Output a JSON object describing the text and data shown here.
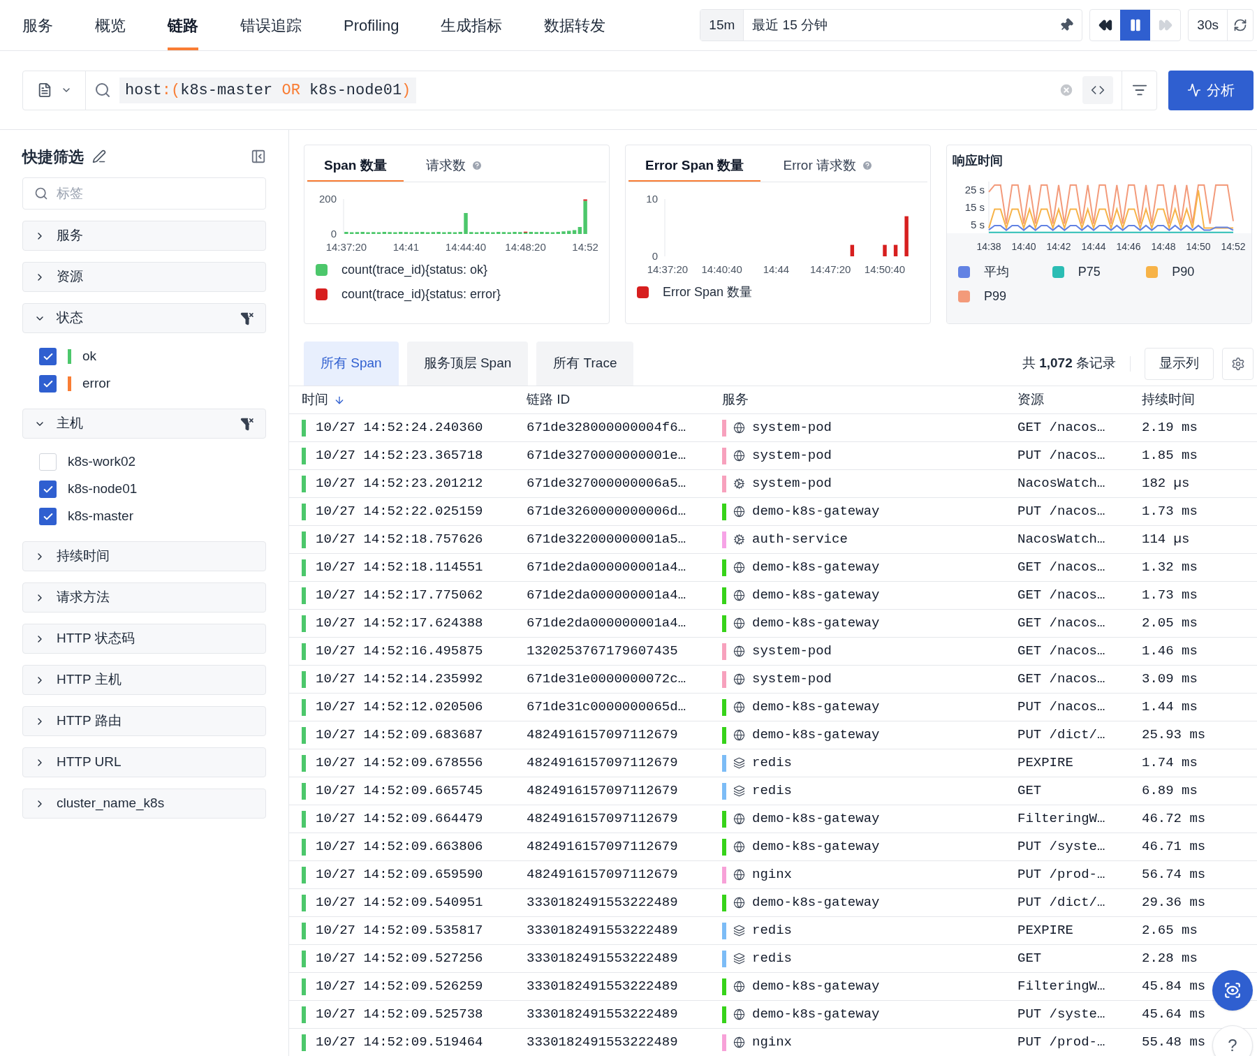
{
  "nav": {
    "tabs": [
      {
        "label": "服务",
        "selected": false
      },
      {
        "label": "概览",
        "selected": false
      },
      {
        "label": "链路",
        "selected": true
      },
      {
        "label": "错误追踪",
        "selected": false
      },
      {
        "label": "Profiling",
        "selected": false
      },
      {
        "label": "生成指标",
        "selected": false
      },
      {
        "label": "数据转发",
        "selected": false
      }
    ],
    "time_range": {
      "short": "15m",
      "label": "最近 15 分钟"
    },
    "live": true,
    "refresh": "30s"
  },
  "query": {
    "tokens": [
      {
        "text": "host",
        "kind": "field"
      },
      {
        "text": ":(",
        "kind": "op"
      },
      {
        "text": "k8s-master ",
        "kind": "value"
      },
      {
        "text": "OR",
        "kind": "op"
      },
      {
        "text": " k8s-node01",
        "kind": "value"
      },
      {
        "text": ")",
        "kind": "op"
      }
    ],
    "analyze_button": "分析"
  },
  "quick_filter": {
    "title": "快捷筛选",
    "placeholder": "标签",
    "groups": [
      {
        "label": "服务",
        "expanded": false
      },
      {
        "label": "资源",
        "expanded": false
      },
      {
        "label": "状态",
        "expanded": true,
        "items": [
          {
            "label": "ok",
            "checked": true,
            "color": "#4cc76b"
          },
          {
            "label": "error",
            "checked": true,
            "color": "#f97d34"
          }
        ]
      },
      {
        "label": "主机",
        "expanded": true,
        "items": [
          {
            "label": "k8s-work02",
            "checked": false
          },
          {
            "label": "k8s-node01",
            "checked": true
          },
          {
            "label": "k8s-master",
            "checked": true
          }
        ]
      },
      {
        "label": "持续时间",
        "expanded": false
      },
      {
        "label": "请求方法",
        "expanded": false
      },
      {
        "label": "HTTP 状态码",
        "expanded": false
      },
      {
        "label": "HTTP 主机",
        "expanded": false
      },
      {
        "label": "HTTP 路由",
        "expanded": false
      },
      {
        "label": "HTTP URL",
        "expanded": false
      },
      {
        "label": "cluster_name_k8s",
        "expanded": false
      }
    ]
  },
  "charts": [
    {
      "tabs": [
        {
          "label": "Span 数量",
          "selected": true,
          "help": false
        },
        {
          "label": "请求数",
          "selected": false,
          "help": true
        }
      ],
      "chart_data": {
        "type": "bar",
        "stacked": true,
        "ylim": [
          0,
          200
        ],
        "yticks": [
          0,
          200
        ],
        "categories": [
          "14:37:20",
          null,
          null,
          null,
          null,
          null,
          null,
          null,
          null,
          null,
          null,
          "14:41",
          null,
          null,
          null,
          null,
          null,
          null,
          null,
          null,
          null,
          null,
          "14:44:40",
          null,
          null,
          null,
          null,
          null,
          null,
          null,
          null,
          null,
          null,
          "14:48:20",
          null,
          null,
          null,
          null,
          null,
          null,
          null,
          null,
          null,
          null,
          "14:52"
        ],
        "series": [
          {
            "name": "count(trace_id){status: ok}",
            "color": "#4cc76b",
            "values": [
              12,
              10,
              11,
              12,
              10,
              11,
              10,
              12,
              11,
              10,
              12,
              11,
              10,
              11,
              12,
              10,
              11,
              12,
              10,
              11,
              10,
              12,
              120,
              11,
              10,
              12,
              11,
              10,
              12,
              11,
              10,
              12,
              11,
              8,
              12,
              11,
              12,
              11,
              10,
              12,
              15,
              18,
              22,
              40,
              190
            ]
          },
          {
            "name": "count(trace_id){status: error}",
            "color": "#d71f1f",
            "values": [
              null,
              null,
              null,
              null,
              null,
              null,
              null,
              null,
              null,
              null,
              null,
              null,
              null,
              null,
              null,
              null,
              null,
              null,
              null,
              null,
              null,
              null,
              null,
              null,
              null,
              null,
              null,
              null,
              null,
              null,
              null,
              null,
              null,
              5,
              null,
              null,
              null,
              null,
              null,
              null,
              null,
              null,
              null,
              null,
              8
            ]
          }
        ]
      }
    },
    {
      "tabs": [
        {
          "label": "Error Span 数量",
          "selected": true,
          "help": false
        },
        {
          "label": "Error 请求数",
          "selected": false,
          "help": true
        }
      ],
      "chart_data": {
        "type": "bar",
        "stacked": false,
        "ylim": [
          0,
          10
        ],
        "yticks": [
          0,
          10
        ],
        "categories": [
          "14:37:20",
          null,
          null,
          null,
          null,
          null,
          null,
          null,
          null,
          null,
          "14:40:40",
          null,
          null,
          null,
          null,
          null,
          null,
          null,
          null,
          null,
          "14:44",
          null,
          null,
          null,
          null,
          null,
          null,
          null,
          null,
          null,
          "14:47:20",
          null,
          null,
          null,
          null,
          null,
          null,
          null,
          null,
          null,
          "14:50:40",
          null,
          null,
          null,
          null
        ],
        "series": [
          {
            "name": "Error Span 数量",
            "color": "#d71f1f",
            "values": [
              0,
              0,
              0,
              0,
              0,
              0,
              0,
              0,
              0,
              0,
              0,
              0,
              0,
              0,
              0,
              0,
              0,
              0,
              0,
              0,
              0,
              0,
              0,
              0,
              0,
              0,
              0,
              0,
              0,
              0,
              0,
              0,
              0,
              0,
              2,
              0,
              0,
              0,
              0,
              0,
              2,
              0,
              2,
              0,
              7
            ]
          }
        ]
      }
    },
    {
      "title": "响应时间",
      "chart_data": {
        "type": "line",
        "ylim": [
          0,
          30
        ],
        "yticks": [
          {
            "value": 5,
            "label": "5 s"
          },
          {
            "value": 15,
            "label": "15 s"
          },
          {
            "value": 25,
            "label": "25 s"
          }
        ],
        "categories": [
          "14:38",
          null,
          null,
          null,
          null,
          null,
          "14:40",
          null,
          null,
          null,
          null,
          null,
          "14:42",
          null,
          null,
          null,
          null,
          null,
          "14:44",
          null,
          null,
          null,
          null,
          null,
          "14:46",
          null,
          null,
          null,
          null,
          null,
          "14:48",
          null,
          null,
          null,
          null,
          null,
          "14:50",
          null,
          null,
          null,
          null,
          null,
          "14:52"
        ],
        "series": [
          {
            "name": "平均",
            "color": "#6282e3",
            "values": [
              2,
              4.5,
              4.5,
              1.8,
              4.5,
              4.5,
              1.8,
              4.5,
              1.8,
              4.5,
              4.5,
              1.8,
              4.5,
              1.8,
              4.5,
              4.5,
              1.8,
              4.5,
              1.8,
              4.5,
              4.5,
              1.8,
              4.5,
              1.8,
              4.5,
              4.5,
              1.8,
              4.5,
              1.8,
              4.5,
              4.5,
              1.8,
              4.5,
              1.8,
              4.5,
              1.8,
              4.5,
              1.8,
              1.8,
              3.5,
              3.5,
              3.5,
              1.8
            ]
          },
          {
            "name": "P75",
            "color": "#2bbdb4",
            "values": [
              0.5,
              0.5,
              0.5,
              0.5,
              0.5,
              0.5,
              0.5,
              0.5,
              0.5,
              0.5,
              0.5,
              0.5,
              0.5,
              0.5,
              0.5,
              0.5,
              0.5,
              0.5,
              0.5,
              0.5,
              0.5,
              0.5,
              0.5,
              0.5,
              0.5,
              0.5,
              0.5,
              0.5,
              0.5,
              0.5,
              0.5,
              0.5,
              0.5,
              0.5,
              0.5,
              0.5,
              0.5,
              0.5,
              0.5,
              0.5,
              0.5,
              0.5,
              0.5
            ]
          },
          {
            "name": "P90",
            "color": "#f7b348",
            "values": [
              3,
              14,
              14,
              3,
              14,
              14,
              3,
              14,
              3,
              14,
              14,
              3,
              14,
              3,
              14,
              14,
              3,
              14,
              3,
              14,
              14,
              3,
              14,
              3,
              14,
              14,
              3,
              14,
              3,
              14,
              14,
              3,
              14,
              3,
              14,
              3,
              25,
              3,
              3,
              3,
              3,
              3,
              3
            ]
          },
          {
            "name": "P99",
            "color": "#f39a7a",
            "values": [
              24,
              28,
              28,
              5.5,
              28,
              28,
              5.5,
              28,
              5.5,
              28,
              28,
              5.5,
              28,
              5.5,
              28,
              28,
              5.5,
              28,
              5.5,
              28,
              28,
              5.5,
              28,
              5.5,
              28,
              28,
              5.5,
              28,
              5.5,
              28,
              28,
              5.5,
              28,
              5.5,
              28,
              5.5,
              28,
              28,
              5.5,
              28,
              28,
              28,
              7
            ]
          }
        ]
      }
    }
  ],
  "table_tabs": [
    {
      "label": "所有 Span",
      "selected": true
    },
    {
      "label": "服务顶层 Span",
      "selected": false
    },
    {
      "label": "所有 Trace",
      "selected": false
    }
  ],
  "record_count": "共 **1,072** 条记录",
  "columns_button": "显示列",
  "table": {
    "columns": [
      {
        "label": "时间",
        "sorted": true
      },
      {
        "label": "链路 ID",
        "sorted": false
      },
      {
        "label": "服务",
        "sorted": false
      },
      {
        "label": "资源",
        "sorted": false
      },
      {
        "label": "持续时间",
        "sorted": false
      }
    ],
    "rows": [
      {
        "error": false,
        "time": "10/27 14:52:24.240360",
        "trace_id": "671de328000000004f6…",
        "service": "system-pod",
        "kind": "web",
        "color": "#f7a1bd",
        "resource": "GET /nacos…",
        "duration": "2.19 ms"
      },
      {
        "error": false,
        "time": "10/27 14:52:23.365718",
        "trace_id": "671de3270000000001e…",
        "service": "system-pod",
        "kind": "web",
        "color": "#f7a1bd",
        "resource": "PUT /nacos…",
        "duration": "1.85 ms"
      },
      {
        "error": false,
        "time": "10/27 14:52:23.201212",
        "trace_id": "671de327000000006a5…",
        "service": "system-pod",
        "kind": "app",
        "color": "#f7a1bd",
        "resource": "NacosWatch…",
        "duration": "182 µs"
      },
      {
        "error": false,
        "time": "10/27 14:52:22.025159",
        "trace_id": "671de3260000000006d…",
        "service": "demo-k8s-gateway",
        "kind": "web",
        "color": "#37d31a",
        "resource": "PUT /nacos…",
        "duration": "1.73 ms"
      },
      {
        "error": false,
        "time": "10/27 14:52:18.757626",
        "trace_id": "671de322000000001a5…",
        "service": "auth-service",
        "kind": "app",
        "color": "#f6a3e6",
        "resource": "NacosWatch…",
        "duration": "114 µs"
      },
      {
        "error": false,
        "time": "10/27 14:52:18.114551",
        "trace_id": "671de2da000000001a4…",
        "service": "demo-k8s-gateway",
        "kind": "web",
        "color": "#37d31a",
        "resource": "GET /nacos…",
        "duration": "1.32 ms"
      },
      {
        "error": false,
        "time": "10/27 14:52:17.775062",
        "trace_id": "671de2da000000001a4…",
        "service": "demo-k8s-gateway",
        "kind": "web",
        "color": "#37d31a",
        "resource": "GET /nacos…",
        "duration": "1.73 ms"
      },
      {
        "error": false,
        "time": "10/27 14:52:17.624388",
        "trace_id": "671de2da000000001a4…",
        "service": "demo-k8s-gateway",
        "kind": "web",
        "color": "#37d31a",
        "resource": "GET /nacos…",
        "duration": "2.05 ms"
      },
      {
        "error": false,
        "time": "10/27 14:52:16.495875",
        "trace_id": "1320253767179607435",
        "service": "system-pod",
        "kind": "web",
        "color": "#f7a1bd",
        "resource": "GET /nacos…",
        "duration": "1.46 ms"
      },
      {
        "error": false,
        "time": "10/27 14:52:14.235992",
        "trace_id": "671de31e0000000072c…",
        "service": "system-pod",
        "kind": "web",
        "color": "#f7a1bd",
        "resource": "GET /nacos…",
        "duration": "3.09 ms"
      },
      {
        "error": false,
        "time": "10/27 14:52:12.020506",
        "trace_id": "671de31c0000000065d…",
        "service": "demo-k8s-gateway",
        "kind": "web",
        "color": "#37d31a",
        "resource": "PUT /nacos…",
        "duration": "1.44 ms"
      },
      {
        "error": false,
        "time": "10/27 14:52:09.683687",
        "trace_id": "4824916157097112679",
        "service": "demo-k8s-gateway",
        "kind": "web",
        "color": "#37d31a",
        "resource": "PUT /dict/…",
        "duration": "25.93 ms"
      },
      {
        "error": false,
        "time": "10/27 14:52:09.678556",
        "trace_id": "4824916157097112679",
        "service": "redis",
        "kind": "db",
        "color": "#7cbcf6",
        "resource": "PEXPIRE",
        "duration": "1.74 ms"
      },
      {
        "error": false,
        "time": "10/27 14:52:09.665745",
        "trace_id": "4824916157097112679",
        "service": "redis",
        "kind": "db",
        "color": "#7cbcf6",
        "resource": "GET",
        "duration": "6.89 ms"
      },
      {
        "error": false,
        "time": "10/27 14:52:09.664479",
        "trace_id": "4824916157097112679",
        "service": "demo-k8s-gateway",
        "kind": "web",
        "color": "#37d31a",
        "resource": "FilteringW…",
        "duration": "46.72 ms"
      },
      {
        "error": false,
        "time": "10/27 14:52:09.663806",
        "trace_id": "4824916157097112679",
        "service": "demo-k8s-gateway",
        "kind": "web",
        "color": "#37d31a",
        "resource": "PUT /syste…",
        "duration": "46.71 ms"
      },
      {
        "error": false,
        "time": "10/27 14:52:09.659590",
        "trace_id": "4824916157097112679",
        "service": "nginx",
        "kind": "web",
        "color": "#f7a1d8",
        "resource": "PUT /prod-…",
        "duration": "56.74 ms"
      },
      {
        "error": false,
        "time": "10/27 14:52:09.540951",
        "trace_id": "3330182491553222489",
        "service": "demo-k8s-gateway",
        "kind": "web",
        "color": "#37d31a",
        "resource": "PUT /dict/…",
        "duration": "29.36 ms"
      },
      {
        "error": false,
        "time": "10/27 14:52:09.535817",
        "trace_id": "3330182491553222489",
        "service": "redis",
        "kind": "db",
        "color": "#7cbcf6",
        "resource": "PEXPIRE",
        "duration": "2.65 ms"
      },
      {
        "error": false,
        "time": "10/27 14:52:09.527256",
        "trace_id": "3330182491553222489",
        "service": "redis",
        "kind": "db",
        "color": "#7cbcf6",
        "resource": "GET",
        "duration": "2.28 ms"
      },
      {
        "error": false,
        "time": "10/27 14:52:09.526259",
        "trace_id": "3330182491553222489",
        "service": "demo-k8s-gateway",
        "kind": "web",
        "color": "#37d31a",
        "resource": "FilteringW…",
        "duration": "45.84 ms"
      },
      {
        "error": false,
        "time": "10/27 14:52:09.525738",
        "trace_id": "3330182491553222489",
        "service": "demo-k8s-gateway",
        "kind": "web",
        "color": "#37d31a",
        "resource": "PUT /syste…",
        "duration": "45.64 ms"
      },
      {
        "error": false,
        "time": "10/27 14:52:09.519464",
        "trace_id": "3330182491553222489",
        "service": "nginx",
        "kind": "web",
        "color": "#f7a1d8",
        "resource": "PUT /prod-…",
        "duration": "55.48 ms"
      }
    ]
  },
  "help_button": "?"
}
